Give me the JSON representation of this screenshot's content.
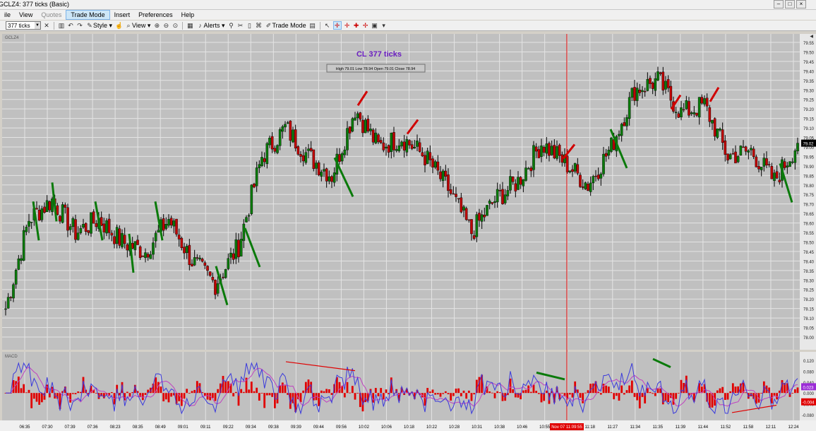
{
  "window": {
    "title": "GCLZ4: 377 ticks (Basic)"
  },
  "menu": [
    {
      "label": "ile",
      "state": "normal"
    },
    {
      "label": "View",
      "state": "normal"
    },
    {
      "label": "Quotes",
      "state": "dim"
    },
    {
      "label": "Trade Mode",
      "state": "active"
    },
    {
      "label": "Insert",
      "state": "normal"
    },
    {
      "label": "Preferences",
      "state": "normal"
    },
    {
      "label": "Help",
      "state": "normal"
    }
  ],
  "toolbar": {
    "interval_value": "377 ticks",
    "style_label": "Style",
    "view_label": "View",
    "alerts_label": "Alerts",
    "trade_mode_label": "Trade Mode"
  },
  "chart": {
    "instrument": "GCLZ4",
    "title": "CL 377  ticks",
    "ohlc": {
      "high_label": "High",
      "high": "79.01",
      "low_label": "Low",
      "low": "78.94",
      "open_label": "Open",
      "open": "79.01",
      "close_label": "Close",
      "close": "78.94"
    },
    "price_labels": [
      "79.55",
      "79.50",
      "79.45",
      "79.40",
      "79.35",
      "79.30",
      "79.25",
      "79.20",
      "79.15",
      "79.10",
      "79.05",
      "79.00",
      "78.95",
      "78.90",
      "78.85",
      "78.80",
      "78.75",
      "78.70",
      "78.65",
      "78.60",
      "78.55",
      "78.50",
      "78.45",
      "78.40",
      "78.35",
      "78.30",
      "78.25",
      "78.20",
      "78.15",
      "78.10",
      "78.05",
      "78.00"
    ],
    "last_price": "79.02",
    "macd_label": "MACD",
    "macd_labels": [
      "0.120",
      "0.080",
      "0.040",
      "0.000",
      "-0.040",
      "-0.080"
    ],
    "macd_value_a": "0.023",
    "macd_value_b": "-0.004",
    "time_labels": [
      "06:35",
      "07:30",
      "07:39",
      "07:36",
      "08:23",
      "08:35",
      "08:49",
      "09:01",
      "09:11",
      "09:22",
      "09:34",
      "09:38",
      "09:39",
      "09:44",
      "09:56",
      "10:02",
      "10:06",
      "10:18",
      "10:22",
      "10:28",
      "10:31",
      "10:38",
      "10:46",
      "10:55",
      "11",
      "11:18",
      "11:27",
      "11:34",
      "11:35",
      "11:39",
      "11:44",
      "11:52",
      "11:58",
      "12:11",
      "12:24"
    ],
    "crosshair_time": "Nov 07 11:09:55",
    "colors": {
      "bg": "#c0c0c0",
      "grid": "#e4e4e4",
      "up": "#0a7a0a",
      "down": "#c00000",
      "wick": "#000000",
      "signal_up": "#0a7a0a",
      "signal_down": "#d00000",
      "macd_line": "#3a3adc",
      "macd_signal": "#c040c0",
      "crosshair": "#e00000",
      "title": "#6a1ec0"
    }
  },
  "chart_data": {
    "type": "candlestick",
    "title": "CL 377  ticks",
    "ylim": [
      78.0,
      79.55
    ],
    "x": [
      "06:35",
      "07:30",
      "07:39",
      "07:36",
      "08:23",
      "08:35",
      "08:49",
      "09:01",
      "09:11",
      "09:22",
      "09:34",
      "09:38",
      "09:39",
      "09:44",
      "09:56",
      "10:02",
      "10:06",
      "10:18",
      "10:22",
      "10:28",
      "10:31",
      "10:38",
      "10:46",
      "10:55",
      "11:09",
      "11:18",
      "11:27",
      "11:34",
      "11:35",
      "11:39",
      "11:44",
      "11:52",
      "11:58",
      "12:11",
      "12:24"
    ],
    "close": [
      78.15,
      78.62,
      78.72,
      78.55,
      78.62,
      78.5,
      78.45,
      78.62,
      78.4,
      78.28,
      78.48,
      78.95,
      79.1,
      78.95,
      78.85,
      79.2,
      79.0,
      79.05,
      78.95,
      78.78,
      78.55,
      78.72,
      78.82,
      79.02,
      78.92,
      78.8,
      79.0,
      79.3,
      79.35,
      79.18,
      79.22,
      78.95,
      78.98,
      78.82,
      79.02
    ],
    "macd": {
      "name": "MACD",
      "ylim": [
        -0.08,
        0.12
      ]
    }
  }
}
